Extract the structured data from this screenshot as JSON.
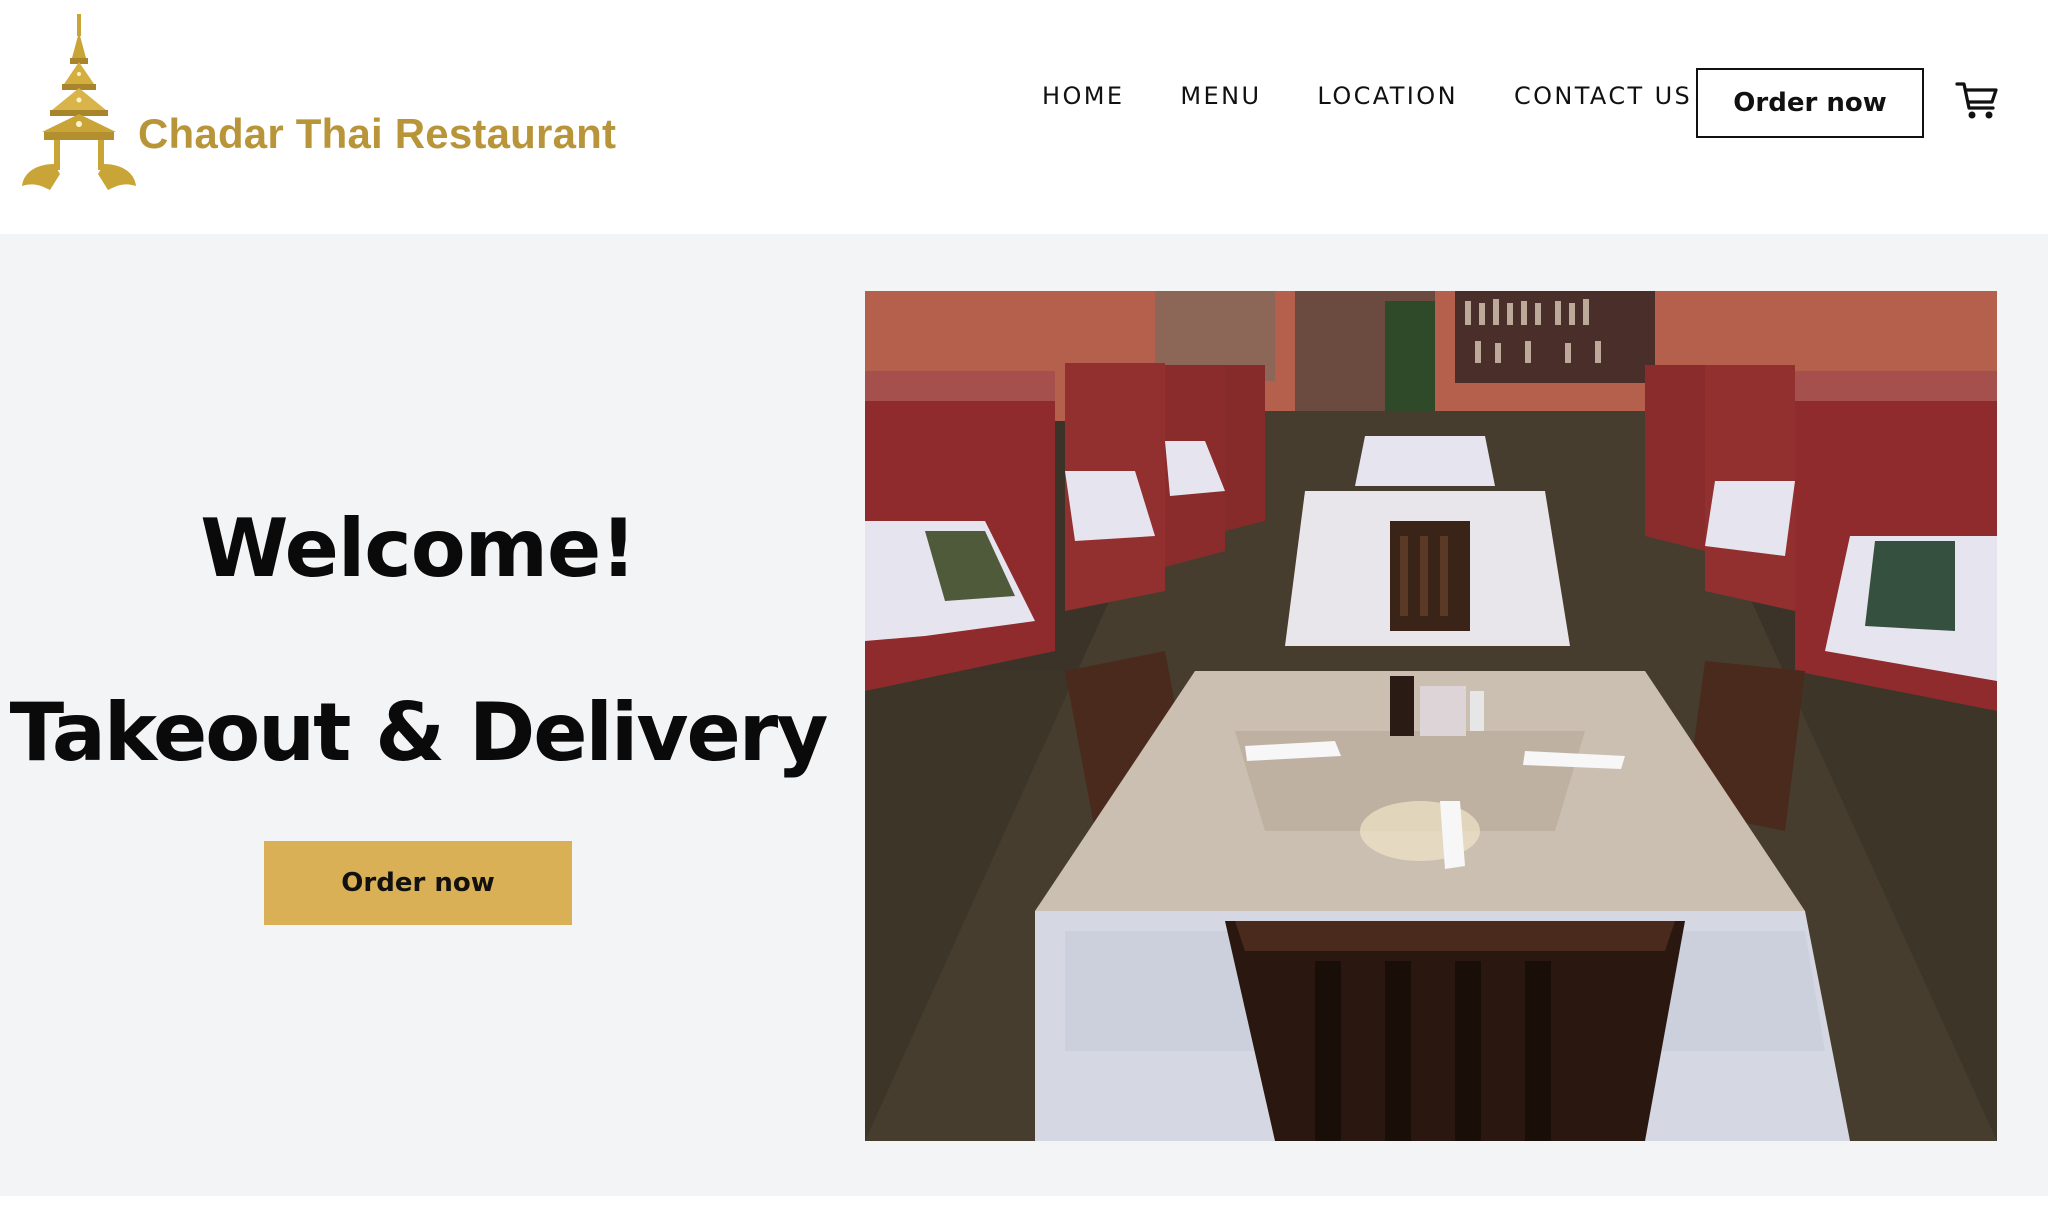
{
  "brand": {
    "name": "Chadar Thai Restaurant",
    "logo_icon": "pagoda-crown-icon",
    "color": "#b9953a"
  },
  "nav": {
    "items": [
      {
        "label": "HOME"
      },
      {
        "label": "MENU"
      },
      {
        "label": "LOCATION"
      },
      {
        "label": "CONTACT US"
      }
    ],
    "order_button": "Order now",
    "cart_icon": "shopping-cart-icon"
  },
  "hero": {
    "heading": "Welcome!",
    "subheading": "Takeout & Delivery",
    "order_button": "Order now",
    "accent_color": "#d9b055",
    "background": "#f3f4f6",
    "image_subject": "restaurant-dining-room-photo"
  }
}
